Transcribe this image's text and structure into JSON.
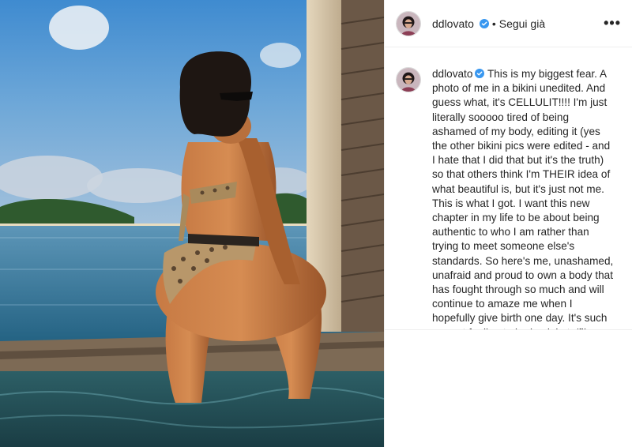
{
  "post": {
    "username": "ddlovato",
    "follow_status": "Segui già",
    "separator": "•",
    "more_label": "•••",
    "caption_username": "ddlovato",
    "caption": "This is my biggest fear. A photo of me in a bikini unedited. And guess what, it's CELLULIT!!!! I'm just literally sooooo tired of being ashamed of my body, editing it (yes the other bikini pics were edited - and I hate that I did that but it's the truth) so that others think I'm THEIR idea of what beautiful is, but it's just not me. This is what I got. I want this new chapter in my life to be about being authentic to who I am rather than trying to meet someone else's standards. So here's me, unashamed, unafraid and proud to own a body that has fought through so much and will continue to amaze me when I hopefully give birth one day. It's such a great feeling to be back in tv/film while not stressing myself with a"
  },
  "colors": {
    "verified_badge": "#3897f0",
    "text": "#262626",
    "border": "#efefef"
  },
  "icons": {
    "verified": "verified-badge-icon",
    "more": "more-options-icon"
  }
}
